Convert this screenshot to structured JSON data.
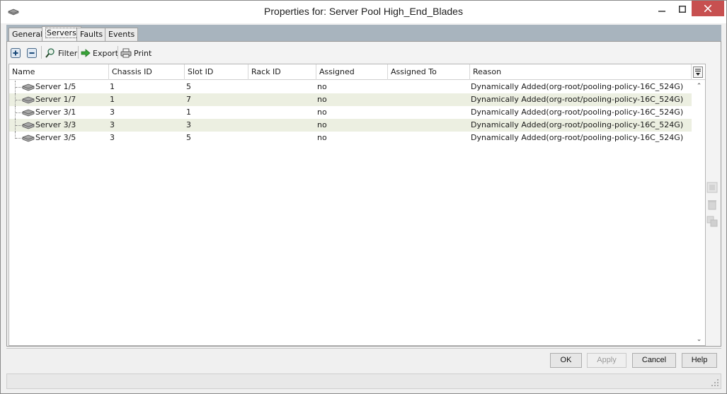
{
  "window": {
    "title": "Properties for: Server Pool High_End_Blades"
  },
  "tabs": [
    {
      "label": "General",
      "active": false
    },
    {
      "label": "Servers",
      "active": true
    },
    {
      "label": "Faults",
      "active": false
    },
    {
      "label": "Events",
      "active": false
    }
  ],
  "toolbar": {
    "add_icon": "plus-icon",
    "remove_icon": "minus-icon",
    "filter_label": "Filter",
    "export_label": "Export",
    "print_label": "Print"
  },
  "table": {
    "columns": [
      "Name",
      "Chassis ID",
      "Slot ID",
      "Rack ID",
      "Assigned",
      "Assigned To",
      "Reason"
    ],
    "rows": [
      {
        "name": "Server 1/5",
        "chassis": "1",
        "slot": "5",
        "rack": "",
        "assigned": "no",
        "assigned_to": "",
        "reason": "Dynamically Added(org-root/pooling-policy-16C_524G)"
      },
      {
        "name": "Server 1/7",
        "chassis": "1",
        "slot": "7",
        "rack": "",
        "assigned": "no",
        "assigned_to": "",
        "reason": "Dynamically Added(org-root/pooling-policy-16C_524G)"
      },
      {
        "name": "Server 3/1",
        "chassis": "3",
        "slot": "1",
        "rack": "",
        "assigned": "no",
        "assigned_to": "",
        "reason": "Dynamically Added(org-root/pooling-policy-16C_524G)"
      },
      {
        "name": "Server 3/3",
        "chassis": "3",
        "slot": "3",
        "rack": "",
        "assigned": "no",
        "assigned_to": "",
        "reason": "Dynamically Added(org-root/pooling-policy-16C_524G)"
      },
      {
        "name": "Server 3/5",
        "chassis": "3",
        "slot": "5",
        "rack": "",
        "assigned": "no",
        "assigned_to": "",
        "reason": "Dynamically Added(org-root/pooling-policy-16C_524G)"
      }
    ]
  },
  "buttons": {
    "ok": "OK",
    "apply": "Apply",
    "cancel": "Cancel",
    "help": "Help"
  },
  "colors": {
    "alt_row": "#ecefe1",
    "tab_strip": "#a8b4be",
    "close_button": "#c75050"
  }
}
